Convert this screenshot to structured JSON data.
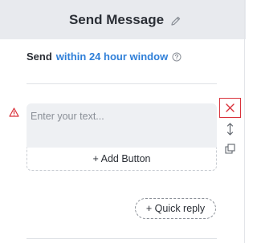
{
  "header": {
    "title": "Send Message",
    "edit_icon": "pencil-icon"
  },
  "send_window": {
    "prefix": "Send",
    "link": "within 24 hour window",
    "help_icon": "question-circle-icon"
  },
  "message_block": {
    "warning_icon": "warning-triangle-icon",
    "text_placeholder": "Enter your text...",
    "text_value": "",
    "add_button_label": "+ Add Button"
  },
  "toolbar": {
    "close_icon": "close-icon",
    "move_icon": "move-vertical-icon",
    "copy_icon": "copy-icon"
  },
  "quick_reply_label": "+ Quick reply",
  "colors": {
    "accent": "#2f7fd8",
    "error": "#d9323b",
    "header_bg": "#e8eaee",
    "input_bg": "#eef0f3",
    "text": "#2b2f36"
  }
}
